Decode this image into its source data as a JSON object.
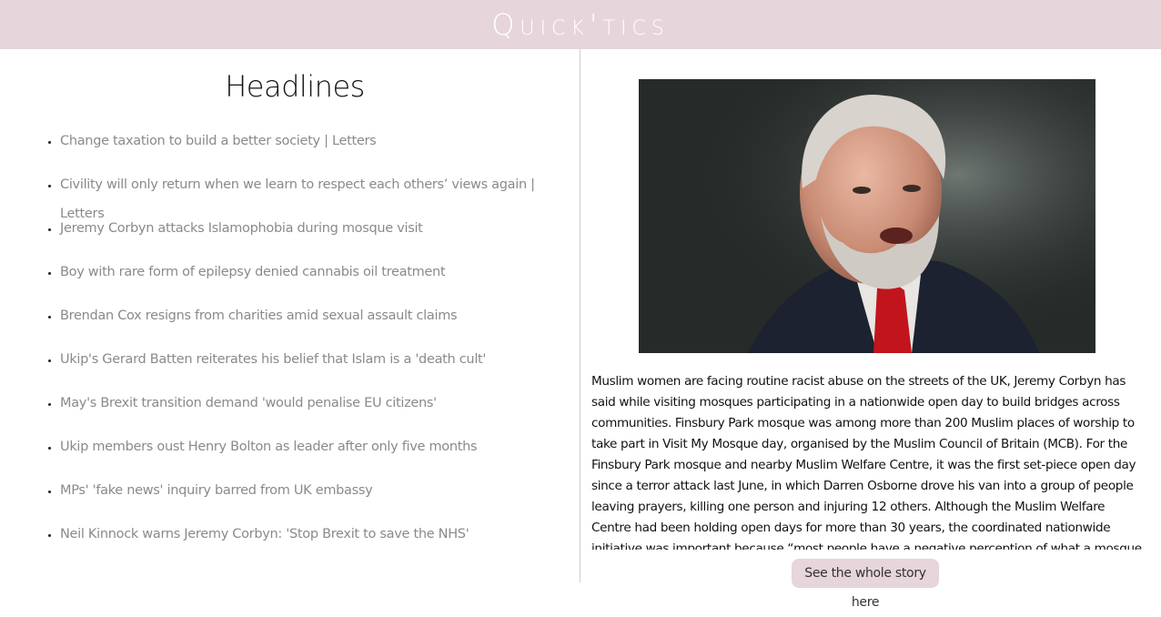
{
  "app": {
    "title": "Quick'tics",
    "colors": {
      "topbar": "#e6d5db",
      "headline_link": "#8a8a8a",
      "button_bg": "#e6d5db"
    }
  },
  "headlines": {
    "title": "Headlines",
    "items": [
      {
        "label": "Change taxation to build a better society | Letters"
      },
      {
        "label": "Civility will only return when we learn to respect each others’ views again | Letters"
      },
      {
        "label": "Jeremy Corbyn attacks Islamophobia during mosque visit"
      },
      {
        "label": "Boy with rare form of epilepsy denied cannabis oil treatment"
      },
      {
        "label": "Brendan Cox resigns from charities amid sexual assault claims"
      },
      {
        "label": "Ukip's Gerard Batten reiterates his belief that Islam is a 'death cult'"
      },
      {
        "label": "May's Brexit transition demand 'would penalise EU citizens'"
      },
      {
        "label": "Ukip members oust Henry Bolton as leader after only five months"
      },
      {
        "label": "MPs' 'fake news' inquiry barred from UK embassy"
      },
      {
        "label": "Neil Kinnock warns Jeremy Corbyn: 'Stop Brexit to save the NHS'"
      }
    ]
  },
  "story": {
    "image_icon": "portrait-photo",
    "text": "Muslim women are facing routine racist abuse on the streets of the UK, Jeremy Corbyn has said while visiting mosques participating in a nationwide open day to build bridges across communities. Finsbury Park mosque was among more than 200 Muslim places of worship to take part in Visit My Mosque day, organised by the Muslim Council of Britain (MCB). For the Finsbury Park mosque and nearby Muslim Welfare Centre, it was the first set-piece open day since a terror attack last June, in which Darren Osborne drove his van into a group of people leaving prayers, killing one person and injuring 12 others. Although the Muslim Welfare Centre had been holding open days for more than 30 years, the coordinated nationwide initiative was important because “most people have a negative perception of what a mosque is without ever going inside one”, he said. Emily Thornberry, the",
    "button_label": "See the whole story here"
  }
}
